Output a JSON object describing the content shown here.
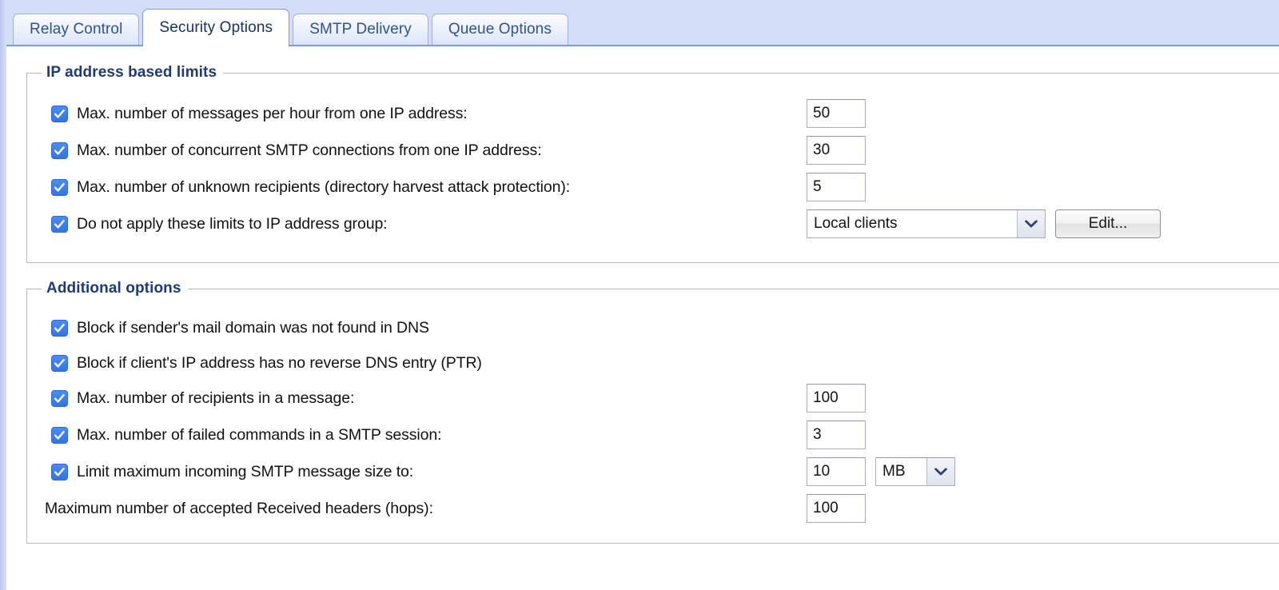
{
  "tabs": [
    {
      "label": "Relay Control",
      "active": false
    },
    {
      "label": "Security Options",
      "active": true
    },
    {
      "label": "SMTP Delivery",
      "active": false
    },
    {
      "label": "Queue Options",
      "active": false
    }
  ],
  "groups": {
    "ip_limits": {
      "legend": "IP address based limits",
      "rows": [
        {
          "checkbox": true,
          "checked": true,
          "label": "Max. number of messages per hour from one IP address:",
          "field": {
            "kind": "text",
            "value": "50"
          }
        },
        {
          "checkbox": true,
          "checked": true,
          "label": "Max. number of concurrent SMTP connections from one IP address:",
          "field": {
            "kind": "text",
            "value": "30"
          }
        },
        {
          "checkbox": true,
          "checked": true,
          "label": "Max. number of unknown recipients (directory harvest attack protection):",
          "field": {
            "kind": "text",
            "value": "5"
          }
        },
        {
          "checkbox": true,
          "checked": true,
          "label": "Do not apply these limits to IP address group:",
          "field": {
            "kind": "combo",
            "value": "Local clients"
          },
          "button": {
            "label": "Edit..."
          }
        }
      ]
    },
    "additional": {
      "legend": "Additional options",
      "rows": [
        {
          "checkbox": true,
          "checked": true,
          "label": "Block if sender's mail domain was not found in DNS",
          "field": null
        },
        {
          "checkbox": true,
          "checked": true,
          "label": "Block if client's IP address has no reverse DNS entry (PTR)",
          "field": null
        },
        {
          "checkbox": true,
          "checked": true,
          "label": "Max. number of recipients in a message:",
          "field": {
            "kind": "text",
            "value": "100"
          }
        },
        {
          "checkbox": true,
          "checked": true,
          "label": "Max. number of failed commands in a SMTP session:",
          "field": {
            "kind": "text",
            "value": "3"
          }
        },
        {
          "checkbox": true,
          "checked": true,
          "label": "Limit maximum incoming SMTP message size to:",
          "field": {
            "kind": "text",
            "value": "10"
          },
          "unit": {
            "kind": "combo",
            "value": "MB"
          }
        },
        {
          "checkbox": false,
          "checked": false,
          "label": "Maximum number of accepted Received headers (hops):",
          "field": {
            "kind": "text",
            "value": "100"
          }
        }
      ]
    }
  },
  "icons": {
    "checkmark": "check-icon",
    "dropdown": "chevron-down-icon"
  },
  "colors": {
    "tabstrip_bg": "#d3ddf7",
    "tabstrip_border": "#7f9ad4",
    "legend_text": "#1d3a7d",
    "tab_text": "#2f5195",
    "active_tab_text": "#16306e",
    "checkbox_blue": "#3b7ef0",
    "field_border": "#a7adc2",
    "group_border": "#b2b9cc"
  }
}
